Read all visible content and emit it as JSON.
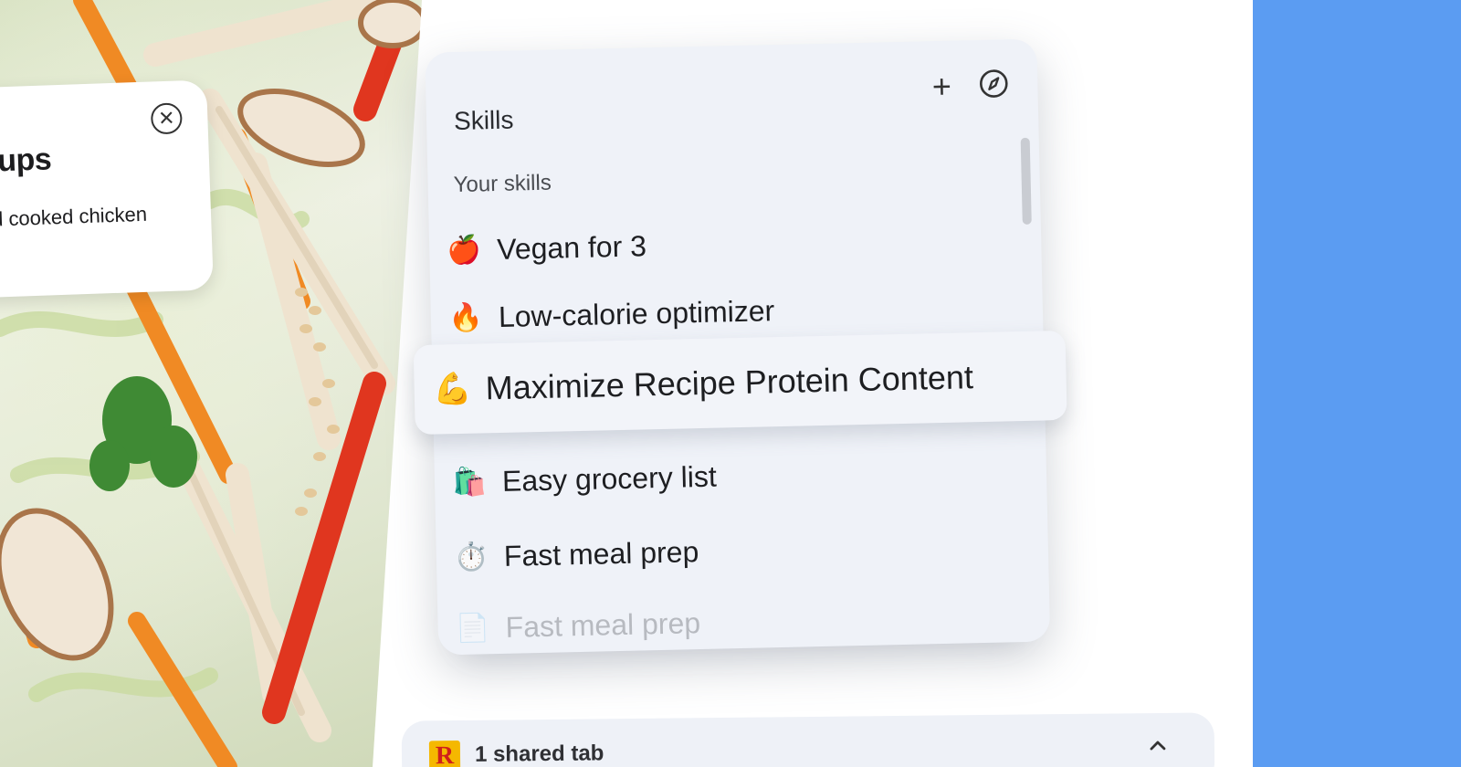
{
  "recipe_card": {
    "title": "cups",
    "subtitle": "d cooked chicken",
    "close_icon": "close-circle-icon"
  },
  "skills": {
    "title": "Skills",
    "add_icon": "plus-icon",
    "explore_icon": "compass-icon",
    "section_label": "Your skills",
    "items": [
      {
        "emoji": "🍎",
        "label": "Vegan for 3"
      },
      {
        "emoji": "🔥",
        "label": "Low-calorie optimizer"
      },
      {
        "emoji": "💪",
        "label": "Maximize Recipe Protein Content"
      },
      {
        "emoji": "🛍️",
        "label": "Easy grocery list"
      },
      {
        "emoji": "⏱️",
        "label": "Fast meal prep"
      },
      {
        "emoji": "📄",
        "label": "Fast meal prep"
      }
    ]
  },
  "shared_tabs": {
    "icon_letter": "R",
    "label": "1 shared tab",
    "chevron_icon": "chevron-up-icon"
  },
  "colors": {
    "accent_blue": "#5b9cf2",
    "panel_bg": "#eff2f8"
  }
}
